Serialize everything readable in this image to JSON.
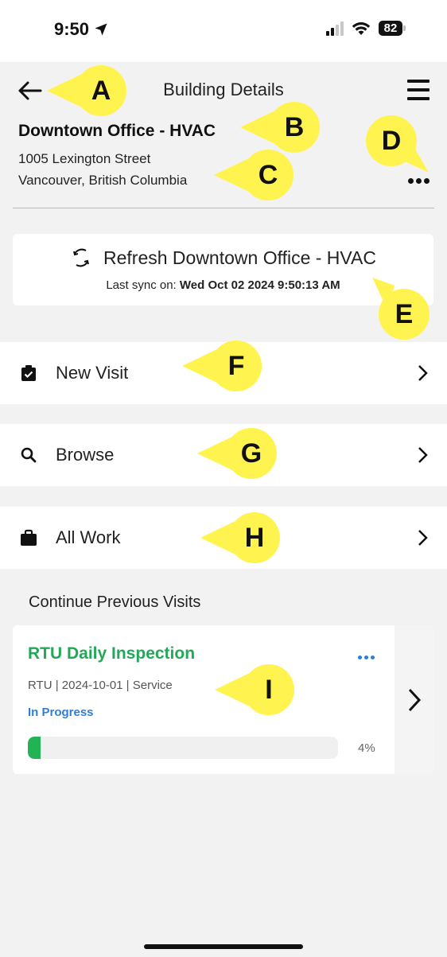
{
  "status_bar": {
    "time": "9:50",
    "battery": "82"
  },
  "header": {
    "title": "Building Details",
    "building_name": "Downtown Office - HVAC",
    "address_line1": "1005 Lexington Street",
    "address_line2": "Vancouver, British Columbia"
  },
  "sync": {
    "title": "Refresh Downtown Office - HVAC",
    "prefix": "Last sync on:",
    "timestamp": "Wed Oct 02 2024 9:50:13 AM"
  },
  "nav": [
    {
      "label": "New Visit",
      "icon": "clipboard-check-icon"
    },
    {
      "label": "Browse",
      "icon": "search-icon"
    },
    {
      "label": "All Work",
      "icon": "briefcase-icon"
    }
  ],
  "previous_visits": {
    "section_title": "Continue Previous Visits",
    "items": [
      {
        "title": "RTU Daily Inspection",
        "meta": "RTU | 2024-10-01 | Service",
        "status": "In Progress",
        "progress_percent": 4,
        "progress_text": "4%"
      }
    ]
  },
  "callouts": [
    "A",
    "B",
    "C",
    "D",
    "E",
    "F",
    "G",
    "H",
    "I"
  ],
  "colors": {
    "title_green": "#23a85a",
    "status_blue": "#2f7fd3",
    "progress_green": "#22b354",
    "callout_yellow": "#fff44f"
  }
}
